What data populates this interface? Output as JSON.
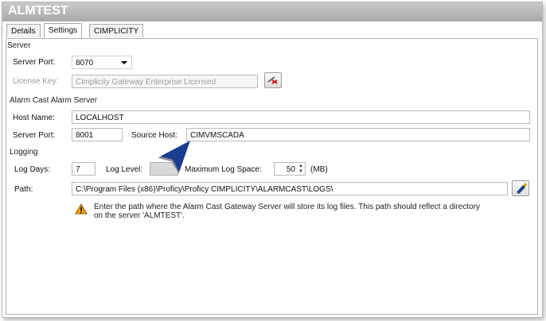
{
  "window": {
    "title": "ALMTEST"
  },
  "tabs": [
    {
      "label": "Details"
    },
    {
      "label": "Settings"
    },
    {
      "label": "CIMPLICITY"
    }
  ],
  "active_tab": "Settings",
  "server": {
    "section_label": "Server",
    "port_label": "Server Port:",
    "port_value": "8070",
    "license_label": "License Key:",
    "license_value": "Cimplicity Gateway Enterprise Licensed"
  },
  "alarm_cast": {
    "section_label": "Alarm Cast Alarm Server",
    "host_label": "Host Name:",
    "host_value": "LOCALHOST",
    "port_label": "Server Port:",
    "port_value": "8001",
    "source_label": "Source Host:",
    "source_value": "CIMVMSCADA"
  },
  "logging": {
    "section_label": "Logging",
    "log_days_label": "Log Days:",
    "log_days_value": "7",
    "log_level_label": "Log Level:",
    "max_space_label": "Maximum Log Space:",
    "max_space_value": "50",
    "max_space_unit": "(MB)",
    "path_label": "Path:",
    "path_value": "C:\\Program Files (x86)\\Proficy\\Proficy CIMPLICITY\\ALARMCAST\\LOGS\\",
    "warning_line1": "Enter the path where the Alarm Cast Gateway Server will store its log files. This path should reflect a directory",
    "warning_line2": "on the server 'ALMTEST'."
  },
  "icons": {
    "license_button": "edit-license-icon",
    "browse_button": "browse-folder-icon",
    "warning": "warning-icon",
    "pointer": "arrow-pointer-icon"
  },
  "colors": {
    "titlebar": "#b4b4b4",
    "warning_fill": "#f0a500",
    "pointer_blue": "#1b3d8f"
  }
}
